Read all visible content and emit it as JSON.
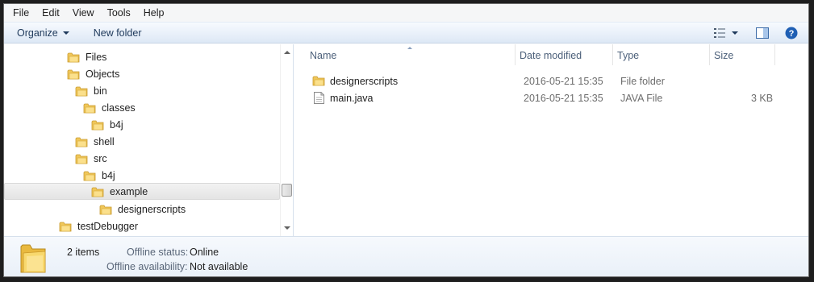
{
  "menubar": {
    "items": [
      "File",
      "Edit",
      "View",
      "Tools",
      "Help"
    ]
  },
  "toolbar": {
    "organize": "Organize",
    "new_folder": "New folder"
  },
  "tree": {
    "items": [
      {
        "label": "Files"
      },
      {
        "label": "Objects"
      },
      {
        "label": "bin"
      },
      {
        "label": "classes"
      },
      {
        "label": "b4j"
      },
      {
        "label": "shell"
      },
      {
        "label": "src"
      },
      {
        "label": "b4j"
      },
      {
        "label": "example"
      },
      {
        "label": "designerscripts"
      },
      {
        "label": "testDebugger"
      }
    ],
    "selected": "example"
  },
  "columns": {
    "name": "Name",
    "date_modified": "Date modified",
    "type": "Type",
    "size": "Size"
  },
  "files": [
    {
      "name": "designerscripts",
      "date": "2016-05-21 15:35",
      "type": "File folder",
      "size": "",
      "icon": "folder-icon"
    },
    {
      "name": "main.java",
      "date": "2016-05-21 15:35",
      "type": "JAVA File",
      "size": "3 KB",
      "icon": "document-icon"
    }
  ],
  "details": {
    "count": "2 items",
    "offline_status_label": "Offline status:",
    "offline_status_value": "Online",
    "offline_availability_label": "Offline availability:",
    "offline_availability_value": "Not available"
  },
  "colors": {
    "folder": "#f2c94c",
    "toolbar_text": "#1e395b",
    "help": "#1f5fb4"
  }
}
